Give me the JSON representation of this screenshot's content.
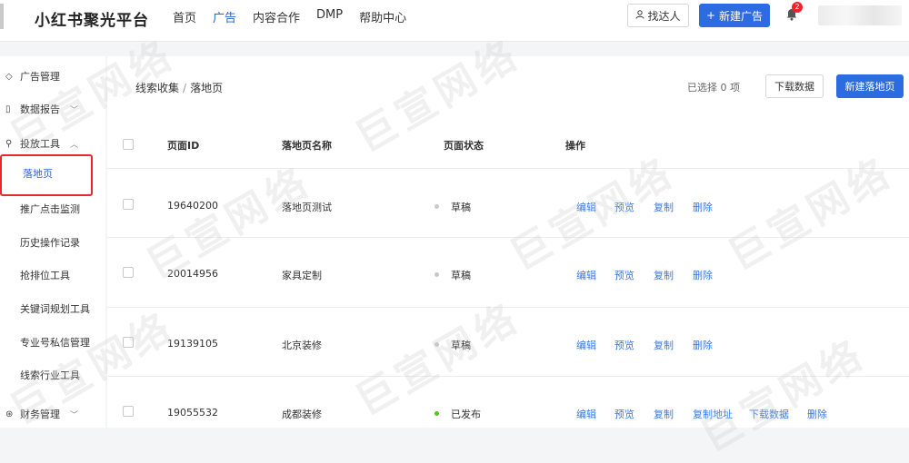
{
  "header": {
    "brand": "小红书聚光平台",
    "nav": [
      {
        "label": "首页",
        "active": false
      },
      {
        "label": "广告",
        "active": true
      },
      {
        "label": "内容合作",
        "active": false
      },
      {
        "label": "DMP",
        "active": false
      },
      {
        "label": "帮助中心",
        "active": false
      }
    ],
    "find_label": "找达人",
    "new_ad_label": "新建广告",
    "notification_count": "2",
    "accent": "#2d6be3"
  },
  "sidebar": {
    "groups": [
      {
        "label": "广告管理",
        "icon": "tag-icon"
      },
      {
        "label": "数据报告",
        "icon": "report-icon",
        "chevron": "﹀"
      },
      {
        "label": "投放工具",
        "icon": "tool-icon",
        "chevron": "︿"
      }
    ],
    "active_item": "落地页",
    "items": [
      "推广点击监测",
      "历史操作记录",
      "抢排位工具",
      "关键词规划工具",
      "专业号私信管理",
      "线索行业工具"
    ],
    "bottom": {
      "label": "财务管理",
      "icon": "finance-icon",
      "chevron": "﹀"
    }
  },
  "main": {
    "breadcrumb": [
      "线索收集",
      "落地页"
    ],
    "breadcrumb_sep": "/",
    "selected_text": "已选择 0 项",
    "download_label": "下载数据",
    "new_landing_label": "新建落地页",
    "columns": [
      "页面ID",
      "落地页名称",
      "页面状态",
      "操作"
    ],
    "rows": [
      {
        "id": "19640200",
        "name": "落地页测试",
        "status": "草稿",
        "status_color": "#c8c8c8",
        "ops": [
          "编辑",
          "预览",
          "复制",
          "删除"
        ]
      },
      {
        "id": "20014956",
        "name": "家具定制",
        "status": "草稿",
        "status_color": "#c8c8c8",
        "ops": [
          "编辑",
          "预览",
          "复制",
          "删除"
        ]
      },
      {
        "id": "19139105",
        "name": "北京装修",
        "status": "草稿",
        "status_color": "#c8c8c8",
        "ops": [
          "编辑",
          "预览",
          "复制",
          "删除"
        ]
      },
      {
        "id": "19055532",
        "name": "成都装修",
        "status": "已发布",
        "status_color": "#52c41a",
        "ops": [
          "编辑",
          "预览",
          "复制",
          "复制地址",
          "下载数据",
          "删除"
        ]
      }
    ]
  },
  "watermark": "巨宣网络"
}
